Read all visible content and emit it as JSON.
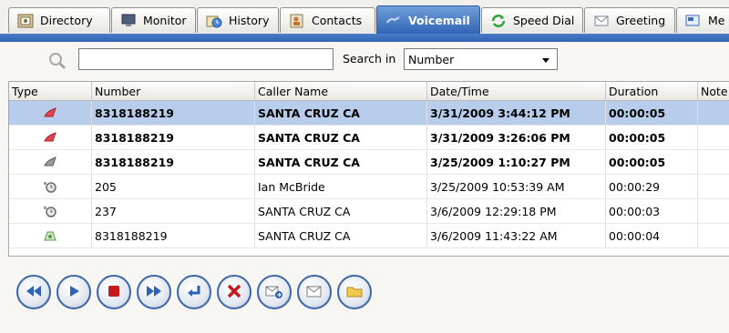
{
  "tabs": [
    {
      "label": "Directory",
      "icon": "directory-icon"
    },
    {
      "label": "Monitor",
      "icon": "monitor-icon"
    },
    {
      "label": "History",
      "icon": "history-icon"
    },
    {
      "label": "Contacts",
      "icon": "contacts-icon"
    },
    {
      "label": "Voicemail",
      "icon": "voicemail-icon",
      "active": true
    },
    {
      "label": "Speed Dial",
      "icon": "speed-dial-icon"
    },
    {
      "label": "Greeting",
      "icon": "greeting-icon"
    },
    {
      "label": "Me",
      "icon": "messages-icon"
    }
  ],
  "search": {
    "value": "",
    "label": "Search in",
    "field": "Number"
  },
  "table": {
    "columns": [
      "Type",
      "Number",
      "Caller Name",
      "Date/Time",
      "Duration",
      "Note"
    ],
    "rows": [
      {
        "type": "urgent-unread",
        "number": "8318188219",
        "caller": "SANTA CRUZ  CA",
        "datetime": "3/31/2009 3:44:12 PM",
        "duration": "00:00:05",
        "note": ""
      },
      {
        "type": "urgent-unread",
        "number": "8318188219",
        "caller": "SANTA CRUZ  CA",
        "datetime": "3/31/2009 3:26:06 PM",
        "duration": "00:00:05",
        "note": ""
      },
      {
        "type": "unread",
        "number": "8318188219",
        "caller": "SANTA CRUZ  CA",
        "datetime": "3/25/2009 1:10:27 PM",
        "duration": "00:00:05",
        "note": ""
      },
      {
        "type": "saved",
        "number": "205",
        "caller": "Ian McBride",
        "datetime": "3/25/2009 10:53:39 AM",
        "duration": "00:00:29",
        "note": ""
      },
      {
        "type": "saved",
        "number": "237",
        "caller": "SANTA CRUZ  CA",
        "datetime": "3/6/2009 12:29:18 PM",
        "duration": "00:00:03",
        "note": ""
      },
      {
        "type": "heard",
        "number": "8318188219",
        "caller": "SANTA CRUZ  CA",
        "datetime": "3/6/2009 11:43:22 AM",
        "duration": "00:00:04",
        "note": ""
      }
    ]
  },
  "controls": [
    {
      "name": "rewind-button",
      "icon": "rewind-icon"
    },
    {
      "name": "play-button",
      "icon": "play-icon"
    },
    {
      "name": "stop-button",
      "icon": "stop-icon"
    },
    {
      "name": "fast-forward-button",
      "icon": "fast-forward-icon"
    },
    {
      "name": "call-back-button",
      "icon": "return-arrow-icon"
    },
    {
      "name": "delete-button",
      "icon": "delete-x-icon"
    },
    {
      "name": "forward-message-button",
      "icon": "forward-envelope-icon"
    },
    {
      "name": "mark-read-button",
      "icon": "envelope-icon"
    },
    {
      "name": "save-to-folder-button",
      "icon": "folder-icon"
    }
  ],
  "colors": {
    "accent": "#2f63b6",
    "selected_row": "#b7cdeb",
    "control_border": "#3c66a8"
  }
}
